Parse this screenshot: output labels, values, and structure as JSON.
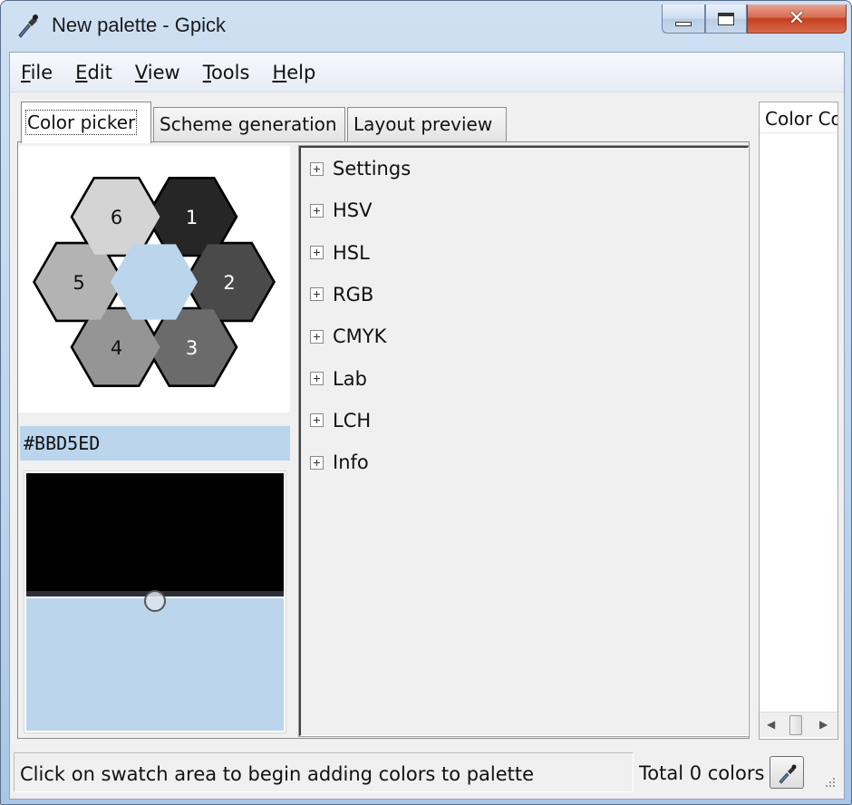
{
  "window": {
    "title": "New palette - Gpick",
    "close_glyph": "✕"
  },
  "menu": {
    "items": [
      {
        "label": "File",
        "mnemonic": "F",
        "rest": "ile"
      },
      {
        "label": "Edit",
        "mnemonic": "E",
        "rest": "dit"
      },
      {
        "label": "View",
        "mnemonic": "V",
        "rest": "iew"
      },
      {
        "label": "Tools",
        "mnemonic": "T",
        "rest": "ools"
      },
      {
        "label": "Help",
        "mnemonic": "H",
        "rest": "elp"
      }
    ]
  },
  "tabs": [
    {
      "label": "Color picker",
      "active": true
    },
    {
      "label": "Scheme generation",
      "active": false
    },
    {
      "label": "Layout preview",
      "active": false
    }
  ],
  "hexagons": [
    {
      "label": "1",
      "color": "#262626",
      "text_color": "#ffffff"
    },
    {
      "label": "2",
      "color": "#4a4a4a",
      "text_color": "#ffffff"
    },
    {
      "label": "3",
      "color": "#6b6b6b",
      "text_color": "#ffffff"
    },
    {
      "label": "4",
      "color": "#959595",
      "text_color": "#111111"
    },
    {
      "label": "5",
      "color": "#b3b3b3",
      "text_color": "#111111"
    },
    {
      "label": "6",
      "color": "#d4d4d4",
      "text_color": "#111111"
    }
  ],
  "current_color": {
    "hex": "#BBD5ED",
    "color": "#bbd5ed"
  },
  "tree": {
    "items": [
      {
        "label": "Settings"
      },
      {
        "label": "HSV"
      },
      {
        "label": "HSL"
      },
      {
        "label": "RGB"
      },
      {
        "label": "CMYK"
      },
      {
        "label": "Lab"
      },
      {
        "label": "LCH"
      },
      {
        "label": "Info"
      }
    ]
  },
  "palette_panel": {
    "column_header": "Color Co"
  },
  "status": {
    "message": "Click on swatch area to begin adding colors to palette",
    "total": "Total 0 colors"
  }
}
